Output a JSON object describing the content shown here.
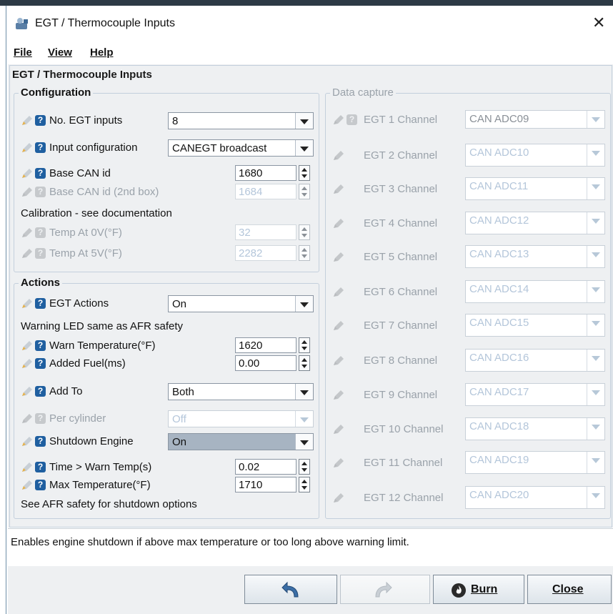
{
  "window": {
    "title": "EGT / Thermocouple Inputs"
  },
  "menu": [
    "File",
    "View",
    "Help"
  ],
  "panel_title": "EGT / Thermocouple Inputs",
  "configuration": {
    "title": "Configuration",
    "no_egt_inputs": {
      "label": "No. EGT inputs",
      "value": "8"
    },
    "input_configuration": {
      "label": "Input configuration",
      "value": "CANEGT broadcast"
    },
    "base_can_id": {
      "label": "Base CAN id",
      "value": "1680"
    },
    "base_can_id_2": {
      "label": "Base CAN id (2nd box)",
      "value": "1684"
    },
    "calibration_note": "Calibration - see documentation",
    "temp_0v": {
      "label": "Temp At 0V(°F)",
      "value": "32"
    },
    "temp_5v": {
      "label": "Temp At 5V(°F)",
      "value": "2282"
    }
  },
  "actions": {
    "title": "Actions",
    "egt_actions": {
      "label": "EGT Actions",
      "value": "On"
    },
    "warning_note": "Warning LED same as AFR safety",
    "warn_temperature": {
      "label": "Warn Temperature(°F)",
      "value": "1620"
    },
    "added_fuel": {
      "label": "Added Fuel(ms)",
      "value": "0.00"
    },
    "add_to": {
      "label": "Add To",
      "value": "Both"
    },
    "per_cylinder": {
      "label": "Per cylinder",
      "value": "Off"
    },
    "shutdown_engine": {
      "label": "Shutdown Engine",
      "value": "On"
    },
    "time_warn_temp": {
      "label": "Time > Warn Temp(s)",
      "value": "0.02"
    },
    "max_temperature": {
      "label": "Max Temperature(°F)",
      "value": "1710"
    },
    "shutdown_note": "See AFR safety for shutdown options"
  },
  "data_capture": {
    "title": "Data capture",
    "channels": [
      {
        "label": "EGT 1 Channel",
        "value": "CAN ADC09"
      },
      {
        "label": "EGT 2 Channel",
        "value": "CAN ADC10"
      },
      {
        "label": "EGT 3 Channel",
        "value": "CAN ADC11"
      },
      {
        "label": "EGT 4 Channel",
        "value": "CAN ADC12"
      },
      {
        "label": "EGT 5 Channel",
        "value": "CAN ADC13"
      },
      {
        "label": "EGT 6 Channel",
        "value": "CAN ADC14"
      },
      {
        "label": "EGT 7 Channel",
        "value": "CAN ADC15"
      },
      {
        "label": "EGT 8 Channel",
        "value": "CAN ADC16"
      },
      {
        "label": "EGT 9 Channel",
        "value": "CAN ADC17"
      },
      {
        "label": "EGT 10 Channel",
        "value": "CAN ADC18"
      },
      {
        "label": "EGT 11 Channel",
        "value": "CAN ADC19"
      },
      {
        "label": "EGT 12 Channel",
        "value": "CAN ADC20"
      }
    ]
  },
  "status_text": "Enables engine shutdown if above max temperature or too long above warning limit.",
  "buttons": {
    "burn": "Burn",
    "close": "Close"
  },
  "colors": {
    "help_icon": "#1f5fa0",
    "panel_bg": "#eef0f2",
    "group_border": "#c3cfdc",
    "disabled_text": "#b4c6da"
  }
}
